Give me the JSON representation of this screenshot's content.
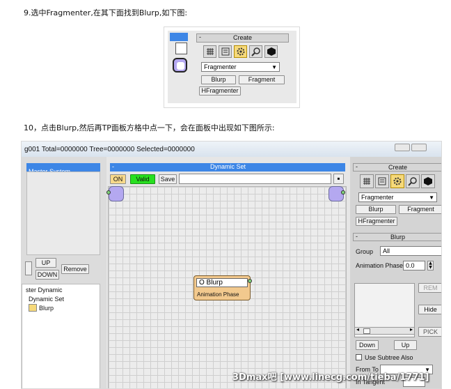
{
  "article": {
    "step9": "9.选中Fragmenter,在其下面找到Blurp,如下图:",
    "step10": "10，点击Blurp,然后再TP面板方格中点一下，会在面板中出现如下图所示:",
    "watermark": "3Dmax吧  [www.linecg.com/tieba/1771]"
  },
  "shot1": {
    "create_title": "Create",
    "dropdown_value": "Fragmenter",
    "buttons": [
      "Blurp",
      "Fragment",
      "HFragmenter"
    ]
  },
  "shot2": {
    "status_bar": "g001  Total=0000000  Tree=0000000  Selected=0000000",
    "master_title": "Master System",
    "up": "UP",
    "down": "DOWN",
    "remove": "Remove",
    "tree": [
      "ster Dynamic",
      "Dynamic Set",
      "Blurp"
    ],
    "dynset_title": "Dynamic Set",
    "on": "ON",
    "valid": "Valid",
    "save": "Save",
    "node_title": "O Blurp",
    "node_port": "Animation Phase",
    "create_title": "Create",
    "dropdown_value": "Fragmenter",
    "blurp_btn": "Blurp",
    "fragment_btn": "Fragment",
    "hfrag_btn": "HFragmenter",
    "blurp_rollout": "Blurp",
    "group_label": "Group",
    "group_value": "All",
    "anim_label": "Animation Phase",
    "anim_value": "0.0",
    "rem": "REM",
    "hide": "Hide",
    "pick": "PICK",
    "down2": "Down",
    "up2": "Up",
    "subtree": "Use Subtree Also",
    "from_to": "From To",
    "in_tangent": "In Tangent"
  },
  "colors": {
    "accent_blue": "#3d86e6",
    "valid_green": "#27e01f",
    "on_orange": "#f7d98a",
    "node_body": "#f2c98e"
  }
}
